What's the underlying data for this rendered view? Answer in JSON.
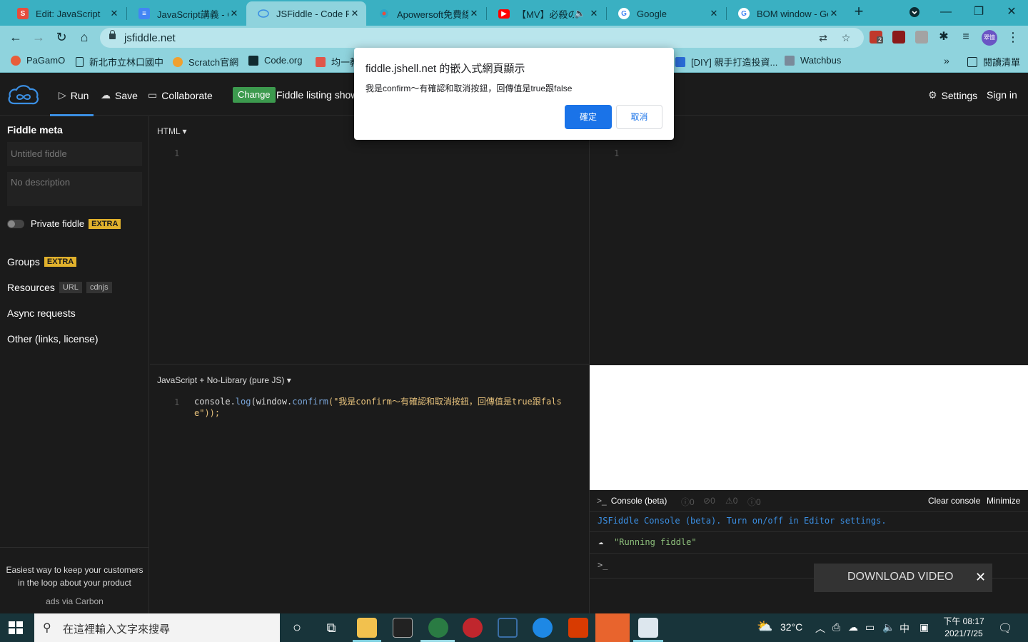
{
  "browser": {
    "tabs": [
      {
        "title": "Edit: JavaScript",
        "favicon": "scratch-s-icon",
        "favicon_color": "#e74c3c"
      },
      {
        "title": "JavaScript講義 - Go",
        "favicon": "docs-icon",
        "favicon_color": "#4285f4"
      },
      {
        "title": "JSFiddle - Code Pla",
        "favicon": "jsfiddle-icon",
        "favicon_color": "#3b8fe3"
      },
      {
        "title": "Apowersoft免費線",
        "favicon": "apowersoft-icon",
        "favicon_color": "#e84c3d"
      },
      {
        "title": "【MV】必殺の",
        "favicon": "youtube-icon",
        "favicon_color": "#ff0000"
      },
      {
        "title": "Google",
        "favicon": "google-icon",
        "favicon_color": "#4285f4"
      },
      {
        "title": "BOM window - Go",
        "favicon": "google-icon",
        "favicon_color": "#4285f4"
      }
    ],
    "address": "jsfiddle.net",
    "extension_badge": "2",
    "avatar_label": "翠憶",
    "bookmarks": [
      {
        "label": "PaGamO",
        "icon": "pagamo-icon"
      },
      {
        "label": "新北市立林口國中",
        "icon": "page-icon"
      },
      {
        "label": "Scratch官網",
        "icon": "scratch-icon"
      },
      {
        "label": "Code.org",
        "icon": "codeorg-icon"
      },
      {
        "label": "均一教",
        "icon": "junyi-icon"
      },
      {
        "label": "[DIY] 親手打造投資...",
        "icon": "chat-icon"
      },
      {
        "label": "Watchbus",
        "icon": "bus-icon"
      },
      {
        "label": "閱讀清單",
        "icon": "reading-list-icon"
      }
    ]
  },
  "jsfiddle": {
    "header": {
      "run": "Run",
      "save": "Save",
      "collaborate": "Collaborate",
      "change": "Change",
      "listing": "Fiddle listing shows",
      "settings": "Settings",
      "sign_in": "Sign in"
    },
    "sidebar": {
      "title": "Fiddle meta",
      "title_placeholder": "Untitled fiddle",
      "description_placeholder": "No description",
      "private": "Private fiddle",
      "extra": "EXTRA",
      "groups": "Groups",
      "resources": "Resources",
      "url_chip": "URL",
      "cdnjs_chip": "cdnjs",
      "async": "Async requests",
      "other": "Other (links, license)",
      "carbon_text": "Easiest way to keep your customers in the loop about your product",
      "carbon_via": "ads via Carbon"
    },
    "html_panel": {
      "label": "HTML ▾",
      "line": "1"
    },
    "css_panel": {
      "line": "1"
    },
    "js_panel": {
      "label": "JavaScript + No-Library (pure JS) ▾",
      "line": "1",
      "code_1a": "console.",
      "code_1b": "log",
      "code_1c": "(window.",
      "code_1d": "confirm",
      "code_1e": "(\"我是confirm～有確認和取消按鈕，回傳值是true跟fals",
      "code_2": "e\"));"
    },
    "console": {
      "title": "Console (beta)",
      "counts": [
        "0",
        "0",
        "0",
        "0"
      ],
      "clear": "Clear console",
      "minimize": "Minimize",
      "info": "JSFiddle Console (beta). Turn on/off in Editor settings.",
      "log": "\"Running fiddle\"",
      "prompt": ">_"
    },
    "download_video": "DOWNLOAD VIDEO"
  },
  "dialog": {
    "title": "fiddle.jshell.net 的嵌入式網頁顯示",
    "message": "我是confirm～有確認和取消按鈕，回傳值是true跟false",
    "ok": "確定",
    "cancel": "取消"
  },
  "taskbar": {
    "search_placeholder": "在這裡輸入文字來搜尋",
    "temperature": "32°C",
    "ime": "中",
    "time": "下午 08:17",
    "date": "2021/7/25"
  },
  "colors": {
    "tab_strip": "#3ab0c2",
    "toolbar": "#8fd3dd",
    "jsf_bg": "#1b1b1b",
    "accent_blue": "#3b8fe3",
    "change_green": "#3c9a4e",
    "extra_yellow": "#e1b12c",
    "dialog_ok": "#1a73e8"
  }
}
